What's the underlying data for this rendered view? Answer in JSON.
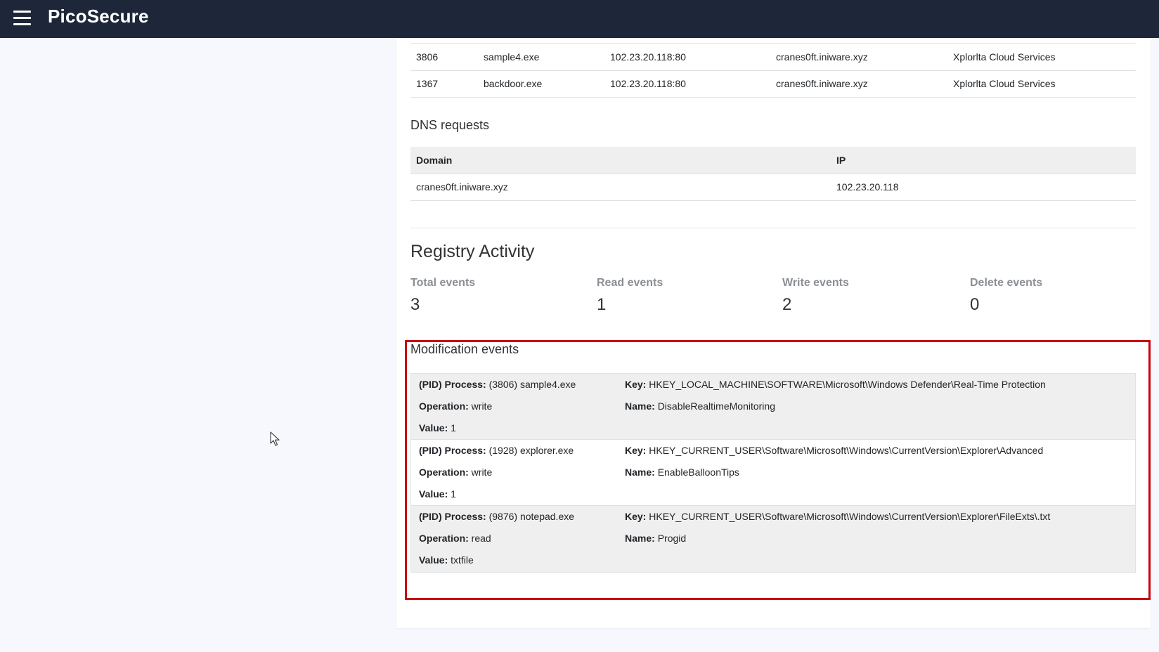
{
  "app": {
    "title": "PicoSecure"
  },
  "connections": [
    {
      "pid": "3806",
      "process": "sample4.exe",
      "address": "102.23.20.118:80",
      "domain": "cranes0ft.iniware.xyz",
      "org": "Xplorlta Cloud Services"
    },
    {
      "pid": "1367",
      "process": "backdoor.exe",
      "address": "102.23.20.118:80",
      "domain": "cranes0ft.iniware.xyz",
      "org": "Xplorlta Cloud Services"
    }
  ],
  "dns": {
    "title": "DNS requests",
    "headers": {
      "domain": "Domain",
      "ip": "IP"
    },
    "rows": [
      {
        "domain": "cranes0ft.iniware.xyz",
        "ip": "102.23.20.118"
      }
    ]
  },
  "registry": {
    "title": "Registry Activity",
    "stats": [
      {
        "label": "Total events",
        "value": "3"
      },
      {
        "label": "Read events",
        "value": "1"
      },
      {
        "label": "Write events",
        "value": "2"
      },
      {
        "label": "Delete events",
        "value": "0"
      }
    ],
    "highlight_color": "#c8000f",
    "modification_title": "Modification events",
    "labels": {
      "process": "(PID) Process:",
      "operation": "Operation:",
      "value": "Value:",
      "key": "Key:",
      "name": "Name:"
    },
    "events": [
      {
        "process": "(3806) sample4.exe",
        "operation": "write",
        "value": "1",
        "key": "HKEY_LOCAL_MACHINE\\SOFTWARE\\Microsoft\\Windows Defender\\Real-Time Protection",
        "name": "DisableRealtimeMonitoring"
      },
      {
        "process": "(1928) explorer.exe",
        "operation": "write",
        "value": "1",
        "key": "HKEY_CURRENT_USER\\Software\\Microsoft\\Windows\\CurrentVersion\\Explorer\\Advanced",
        "name": "EnableBalloonTips"
      },
      {
        "process": "(9876) notepad.exe",
        "operation": "read",
        "value": "txtfile",
        "key": "HKEY_CURRENT_USER\\Software\\Microsoft\\Windows\\CurrentVersion\\Explorer\\FileExts\\.txt",
        "name": "Progid"
      }
    ]
  }
}
